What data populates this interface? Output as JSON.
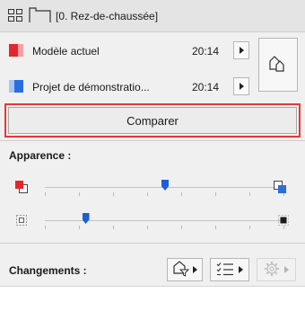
{
  "header": {
    "title": "[0. Rez-de-chaussée]",
    "layout_icon": "grid-layout-icon",
    "story_icon": "floor-plan-icon"
  },
  "rows": [
    {
      "label": "Modèle actuel",
      "time": "20:14",
      "swatch_color": "#e8242c",
      "icon": "arrow-right-icon"
    },
    {
      "label": "Projet de démonstratio...",
      "time": "20:14",
      "swatch_color": "#2a6de0",
      "icon": "arrow-right-icon"
    }
  ],
  "side_button": {
    "icon": "overlay-compare-icon"
  },
  "compare": {
    "label": "Comparer",
    "highlight_color": "#e5373b"
  },
  "appearance": {
    "title": "Apparence :",
    "sliders": [
      {
        "name": "color-overlay",
        "value": 0.5,
        "left_icon": "red-overlay-icon",
        "right_icon": "blue-overlay-icon"
      },
      {
        "name": "opacity",
        "value": 0.17,
        "left_icon": "transparent-square-icon",
        "right_icon": "solid-square-icon"
      }
    ]
  },
  "changes": {
    "title": "Changements :",
    "buttons": [
      {
        "icon": "element-filter-icon",
        "enabled": true
      },
      {
        "icon": "list-icon",
        "enabled": true
      },
      {
        "icon": "settings-icon",
        "enabled": false
      }
    ]
  }
}
